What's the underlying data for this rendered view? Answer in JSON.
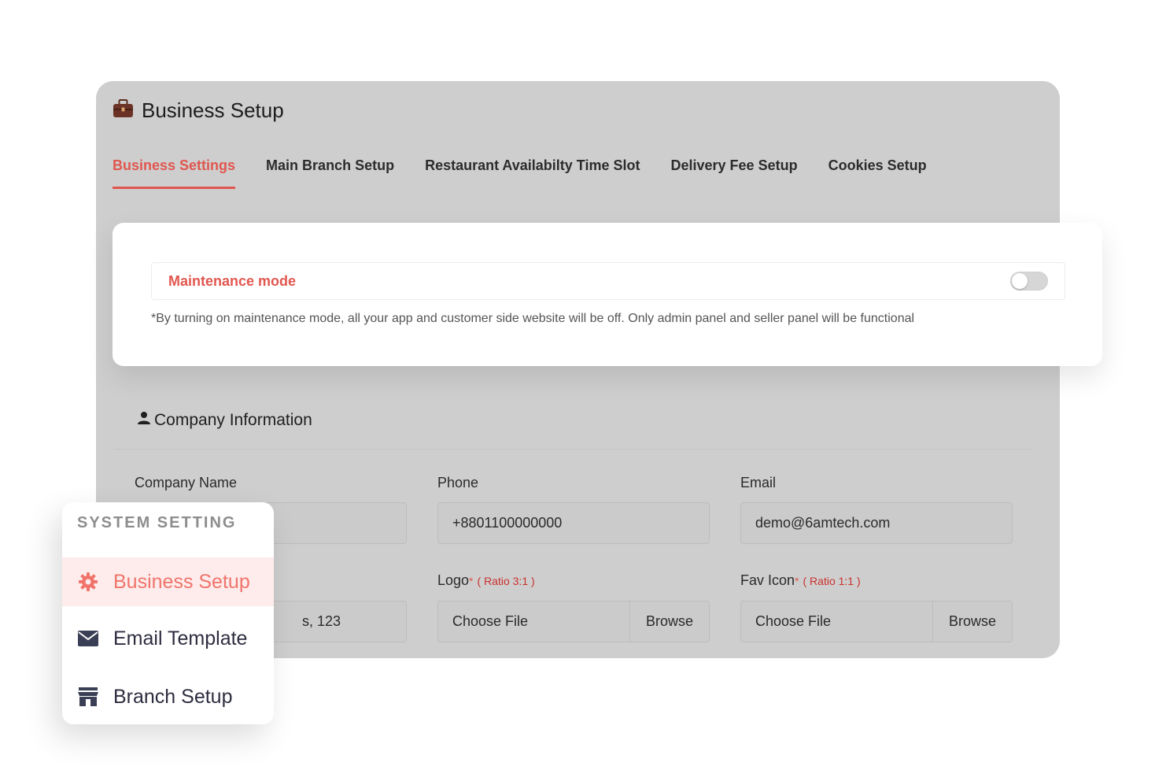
{
  "header": {
    "title": "Business Setup",
    "icon": "briefcase-icon"
  },
  "tabs": [
    {
      "label": "Business Settings",
      "active": true
    },
    {
      "label": "Main Branch Setup",
      "active": false
    },
    {
      "label": "Restaurant Availabilty Time Slot",
      "active": false
    },
    {
      "label": "Delivery Fee Setup",
      "active": false
    },
    {
      "label": "Cookies Setup",
      "active": false
    }
  ],
  "maintenance": {
    "label": "Maintenance mode",
    "enabled": false,
    "note": "*By turning on maintenance mode, all your app and customer side website will be off. Only admin panel and seller panel will be functional"
  },
  "company": {
    "title": "Company Information",
    "fields": {
      "company_name": {
        "label": "Company Name",
        "value": ""
      },
      "phone": {
        "label": "Phone",
        "value": "+8801100000000"
      },
      "email": {
        "label": "Email",
        "value": "demo@6amtech.com"
      },
      "address": {
        "value": "s, 123"
      },
      "logo": {
        "label": "Logo",
        "required": "*",
        "ratio": "( Ratio 3:1 )",
        "file_text": "Choose File",
        "browse": "Browse"
      },
      "fav_icon": {
        "label": "Fav Icon",
        "required": "*",
        "ratio": "( Ratio 1:1 )",
        "file_text": "Choose File",
        "browse": "Browse"
      }
    }
  },
  "system_menu": {
    "title": "SYSTEM SETTING",
    "items": [
      {
        "label": "Business Setup",
        "icon": "gear-icon",
        "active": true
      },
      {
        "label": "Email Template",
        "icon": "envelope-icon",
        "active": false
      },
      {
        "label": "Branch Setup",
        "icon": "store-icon",
        "active": false
      }
    ]
  },
  "colors": {
    "accent": "#e0574f",
    "menu_accent": "#f0746c",
    "panel": "#cecece"
  }
}
